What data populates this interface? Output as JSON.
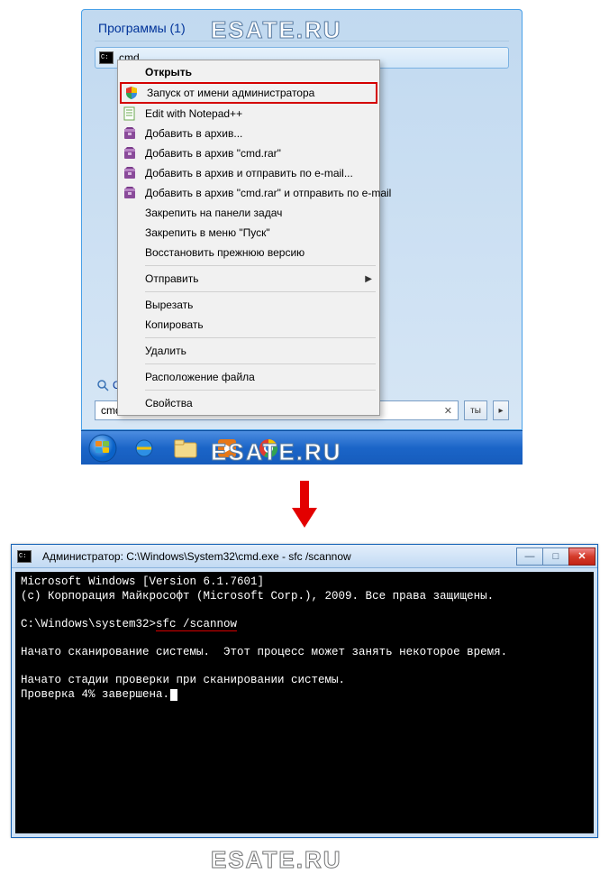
{
  "watermark": "ESATE.RU",
  "startmenu": {
    "header": "Программы (1)",
    "result_label": "cmd",
    "seemore_prefix": "Озна",
    "search_value": "cmd",
    "shutdown_label": "ты"
  },
  "contextmenu": {
    "items": [
      {
        "label": "Открыть",
        "bold": true,
        "icon": "none"
      },
      {
        "label": "Запуск от имени администратора",
        "icon": "shield",
        "highlight": true
      },
      {
        "label": "Edit with Notepad++",
        "icon": "notepad"
      },
      {
        "label": "Добавить в архив...",
        "icon": "winrar"
      },
      {
        "label": "Добавить в архив \"cmd.rar\"",
        "icon": "winrar"
      },
      {
        "label": "Добавить в архив и отправить по e-mail...",
        "icon": "winrar"
      },
      {
        "label": "Добавить в архив \"cmd.rar\" и отправить по e-mail",
        "icon": "winrar"
      },
      {
        "label": "Закрепить на панели задач",
        "icon": "none"
      },
      {
        "label": "Закрепить в меню \"Пуск\"",
        "icon": "none"
      },
      {
        "label": "Восстановить прежнюю версию",
        "icon": "none"
      },
      {
        "sep": true
      },
      {
        "label": "Отправить",
        "icon": "none",
        "submenu": true
      },
      {
        "sep": true
      },
      {
        "label": "Вырезать",
        "icon": "none"
      },
      {
        "label": "Копировать",
        "icon": "none"
      },
      {
        "sep": true
      },
      {
        "label": "Удалить",
        "icon": "none"
      },
      {
        "sep": true
      },
      {
        "label": "Расположение файла",
        "icon": "none"
      },
      {
        "sep": true
      },
      {
        "label": "Свойства",
        "icon": "none"
      }
    ]
  },
  "taskbar": {
    "items": [
      "start",
      "ie",
      "explorer",
      "mediaplayer",
      "chrome"
    ]
  },
  "console": {
    "title": "Администратор: C:\\Windows\\System32\\cmd.exe - sfc  /scannow",
    "line1": "Microsoft Windows [Version 6.1.7601]",
    "line2": "(c) Корпорация Майкрософт (Microsoft Corp.), 2009. Все права защищены.",
    "prompt": "C:\\Windows\\system32>",
    "command": "sfc /scannow",
    "line4": "Начато сканирование системы.  Этот процесс может занять некоторое время.",
    "line5": "Начато стадии проверки при сканировании системы.",
    "line6": "Проверка 4% завершена."
  }
}
